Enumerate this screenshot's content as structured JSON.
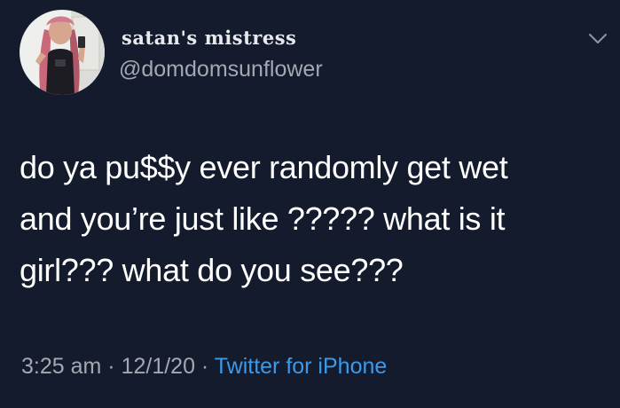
{
  "user": {
    "display_name": "satan's mistress",
    "handle": "@domdomsunflower"
  },
  "tweet": {
    "lines": [
      "do ya pu$$y ever randomly get wet",
      "and you’re just like ????? what is it",
      "girl??? what do you see???"
    ]
  },
  "meta": {
    "time": "3:25 am",
    "separator": " · ",
    "date": "12/1/20",
    "source": "Twitter for iPhone"
  },
  "icons": {
    "avatar": "profile-photo",
    "menu": "chevron-down-icon"
  },
  "colors": {
    "background": "#141b2d",
    "text": "#ffffff",
    "secondary": "#a3a9b0",
    "link": "#3d99e9"
  }
}
